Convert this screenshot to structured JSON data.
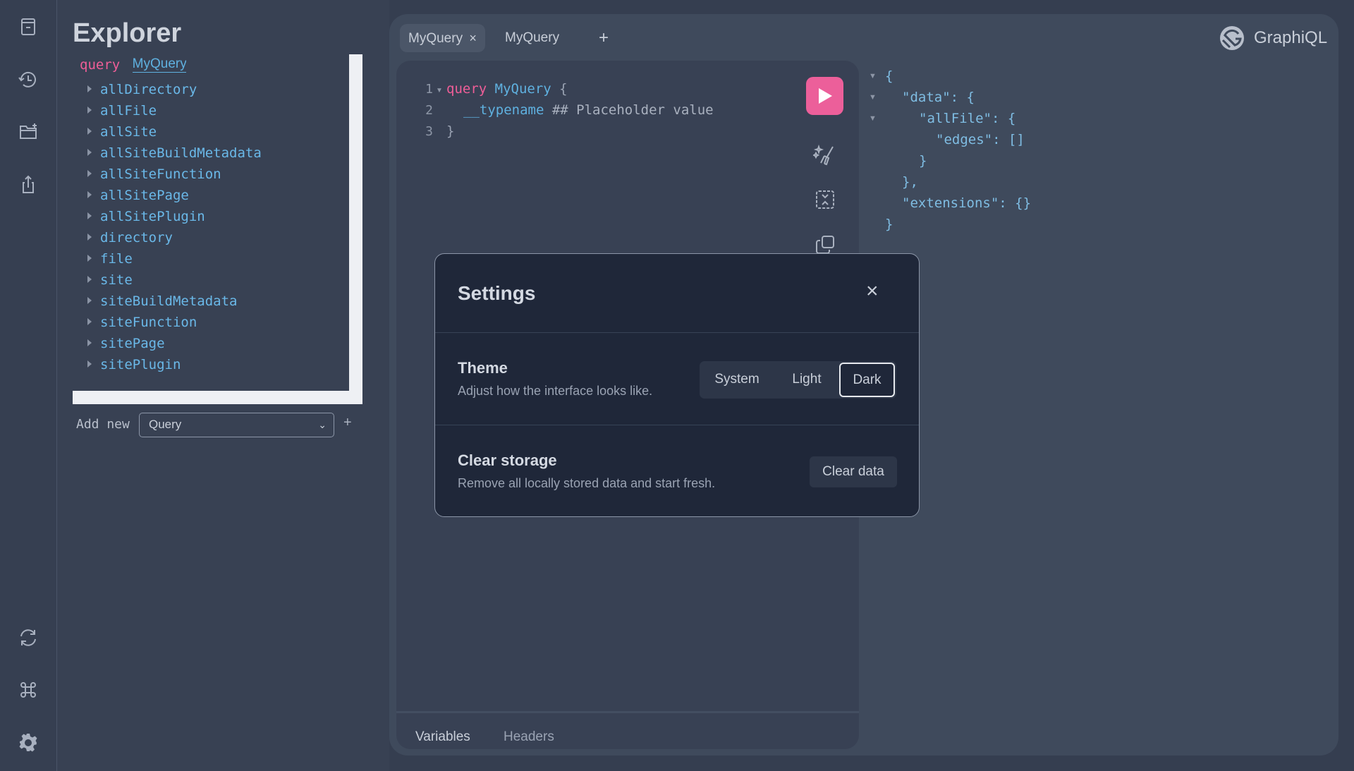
{
  "sidebar": {
    "top_icons": [
      "docs-icon",
      "history-icon",
      "add-folder-icon",
      "share-icon"
    ],
    "bottom_icons": [
      "refresh-icon",
      "command-icon",
      "settings-gear-icon"
    ]
  },
  "explorer": {
    "title": "Explorer",
    "query_keyword": "query",
    "query_name": "MyQuery",
    "items": [
      "allDirectory",
      "allFile",
      "allSite",
      "allSiteBuildMetadata",
      "allSiteFunction",
      "allSitePage",
      "allSitePlugin",
      "directory",
      "file",
      "site",
      "siteBuildMetadata",
      "siteFunction",
      "sitePage",
      "sitePlugin"
    ],
    "add_new_label": "Add new",
    "add_new_select": "Query",
    "add_button": "+"
  },
  "tabs": [
    {
      "label": "MyQuery",
      "close": "×",
      "active": true
    },
    {
      "label": "MyQuery",
      "active": false
    }
  ],
  "add_tab": "+",
  "brand": "GraphiQL",
  "editor": {
    "lines": [
      {
        "num": "1",
        "kw": "query",
        "name": "MyQuery",
        "rest": " {"
      },
      {
        "num": "2",
        "field": "__typename",
        "comment": " ## Placeholder value"
      },
      {
        "num": "3",
        "rest": "}"
      }
    ],
    "bottom_tabs": [
      "Variables",
      "Headers"
    ],
    "run_color": "#ec5f9a"
  },
  "result": {
    "lines": [
      "{",
      "  \"data\": {",
      "    \"allFile\": {",
      "      \"edges\": []",
      "    }",
      "  },",
      "  \"extensions\": {}",
      "}"
    ]
  },
  "settings": {
    "title": "Settings",
    "close": "×",
    "theme": {
      "title": "Theme",
      "desc": "Adjust how the interface looks like.",
      "options": [
        "System",
        "Light",
        "Dark"
      ],
      "selected": "Dark"
    },
    "storage": {
      "title": "Clear storage",
      "desc": "Remove all locally stored data and start fresh.",
      "button": "Clear data"
    }
  }
}
